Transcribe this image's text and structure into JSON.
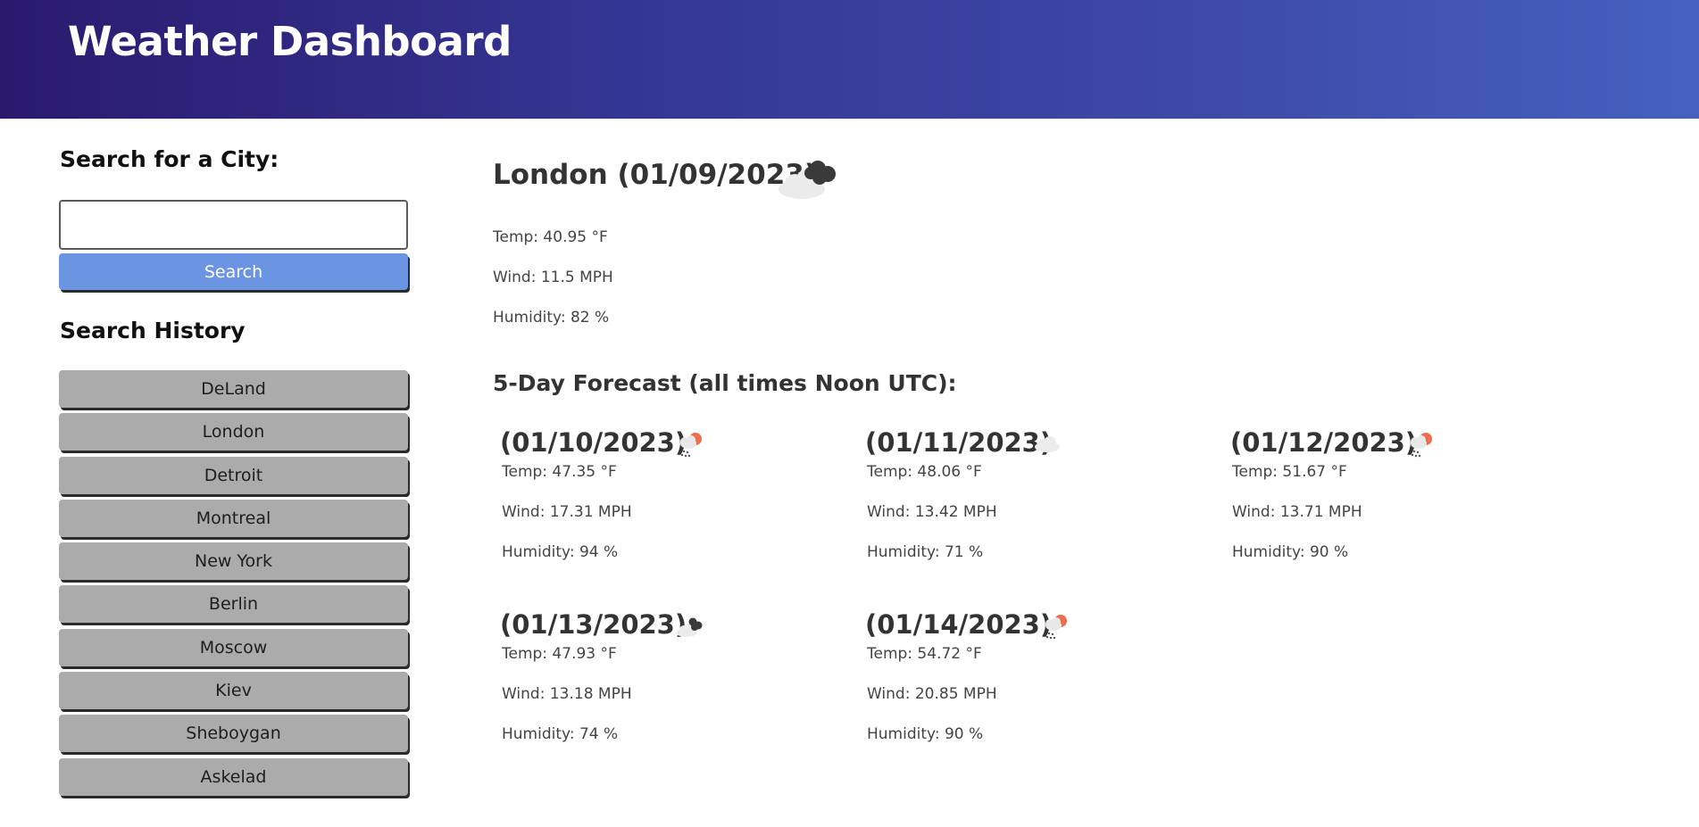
{
  "header": {
    "title": "Weather Dashboard"
  },
  "sidebar": {
    "search_title": "Search for a City:",
    "search_input": {
      "value": "",
      "placeholder": ""
    },
    "search_button": "Search",
    "history_title": "Search History",
    "history": [
      "DeLand",
      "London",
      "Detroit",
      "Montreal",
      "New York",
      "Berlin",
      "Moscow",
      "Kiev",
      "Sheboygan",
      "Askelad"
    ]
  },
  "current": {
    "title": "London (01/09/2023)",
    "icon": "broken-clouds-icon",
    "temp": "Temp: 40.95 °F",
    "wind": "Wind: 11.5 MPH",
    "humidity": "Humidity: 82 %"
  },
  "forecast": {
    "title": "5-Day Forecast (all times Noon UTC):",
    "days": [
      {
        "date": "(01/10/2023)",
        "icon": "rain-sun-icon",
        "temp": "Temp: 47.35 °F",
        "wind": "Wind: 17.31 MPH",
        "humidity": "Humidity: 94 %"
      },
      {
        "date": "(01/11/2023)",
        "icon": "cloud-icon",
        "temp": "Temp: 48.06 °F",
        "wind": "Wind: 13.42 MPH",
        "humidity": "Humidity: 71 %"
      },
      {
        "date": "(01/12/2023)",
        "icon": "rain-sun-icon",
        "temp": "Temp: 51.67 °F",
        "wind": "Wind: 13.71 MPH",
        "humidity": "Humidity: 90 %"
      },
      {
        "date": "(01/13/2023)",
        "icon": "broken-clouds-icon",
        "temp": "Temp: 47.93 °F",
        "wind": "Wind: 13.18 MPH",
        "humidity": "Humidity: 74 %"
      },
      {
        "date": "(01/14/2023)",
        "icon": "rain-sun-icon",
        "temp": "Temp: 54.72 °F",
        "wind": "Wind: 20.85 MPH",
        "humidity": "Humidity: 90 %"
      }
    ]
  },
  "colors": {
    "header_gradient_start": "#2a1a6e",
    "header_gradient_end": "#4561c0",
    "search_button": "#6b95e3",
    "history_button": "#ababab"
  }
}
